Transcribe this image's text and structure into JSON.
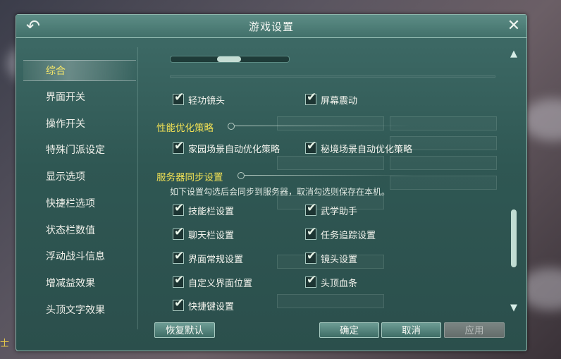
{
  "window": {
    "title": "游戏设置"
  },
  "icons": {
    "back": "back-arrow-icon",
    "close": "close-icon",
    "scroll_up": "triangle-up-icon",
    "scroll_down": "triangle-down-icon"
  },
  "colors": {
    "accent_yellow": "#f2e154",
    "panel_teal": "#2f5753",
    "disabled_button": "#6e7775"
  },
  "sidebar": {
    "items": [
      {
        "label": "综合",
        "active": true
      },
      {
        "label": "界面开关",
        "active": false
      },
      {
        "label": "操作开关",
        "active": false
      },
      {
        "label": "特殊门派设定",
        "active": false
      },
      {
        "label": "显示选项",
        "active": false
      },
      {
        "label": "快捷栏选项",
        "active": false
      },
      {
        "label": "状态栏数值",
        "active": false
      },
      {
        "label": "浮动战斗信息",
        "active": false
      },
      {
        "label": "增减益效果",
        "active": false
      },
      {
        "label": "头顶文字效果",
        "active": false
      }
    ]
  },
  "content": {
    "top_options": [
      {
        "label": "轻功镜头",
        "checked": true
      },
      {
        "label": "屏幕震动",
        "checked": true
      }
    ],
    "perf_section": {
      "title": "性能优化策略",
      "options": [
        {
          "label": "家园场景自动优化策略",
          "checked": true
        },
        {
          "label": "秘境场景自动优化策略",
          "checked": true
        }
      ]
    },
    "sync_section": {
      "title": "服务器同步设置",
      "note": "如下设置勾选后会同步到服务器，取消勾选则保存在本机。",
      "options": [
        {
          "label": "技能栏设置",
          "checked": true
        },
        {
          "label": "武学助手",
          "checked": true
        },
        {
          "label": "聊天栏设置",
          "checked": true
        },
        {
          "label": "任务追踪设置",
          "checked": true
        },
        {
          "label": "界面常规设置",
          "checked": true
        },
        {
          "label": "镜头设置",
          "checked": true
        },
        {
          "label": "自定义界面位置",
          "checked": true
        },
        {
          "label": "头顶血条",
          "checked": true
        },
        {
          "label": "快捷键设置",
          "checked": true
        }
      ]
    }
  },
  "buttons": {
    "restore_default": "恢复默认",
    "confirm": "确定",
    "cancel": "取消",
    "apply": "应用"
  },
  "scroll": {
    "position": 0.62
  }
}
